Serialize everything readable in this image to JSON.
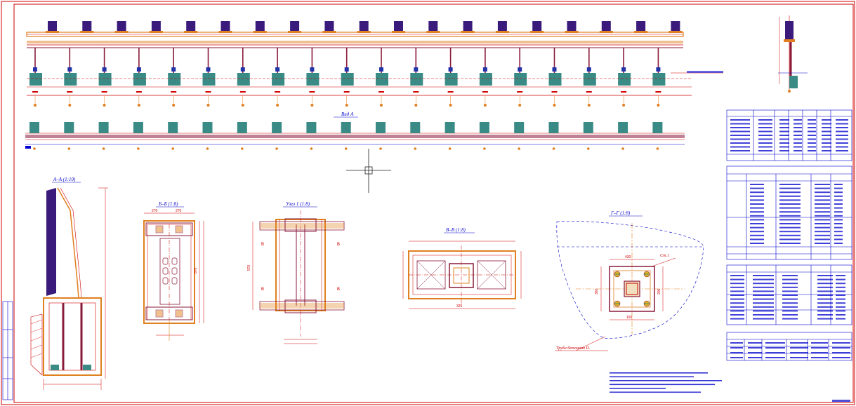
{
  "drawing": {
    "view_a_title": "Вид А",
    "sections": {
      "aa": "А–А (1:10)",
      "bb": "Б–Б (1:8)",
      "node1": "Узел 1 (1:8)",
      "vv": "В–В (1:8)",
      "gg": "Г–Г (1:8)"
    },
    "labels": {
      "pipe": "Труба бетонная D.",
      "st": "Ст.1"
    },
    "dims": {
      "gg_top": "430",
      "gg_left": "360",
      "gg_side": "200",
      "gg_bottom": "160",
      "bb_top_left": "270",
      "bb_top_right": "270",
      "bb_height": "870",
      "vv_overall": "325",
      "node1_height": "570"
    },
    "colors": {
      "frame": "#d00000",
      "column": "#8a1a3a",
      "beam": "#e08020",
      "panel": "#3a1a7a",
      "footing": "#3a8a86",
      "dim": "#d00000",
      "axis": "#e08020",
      "table": "#0000cc"
    }
  }
}
